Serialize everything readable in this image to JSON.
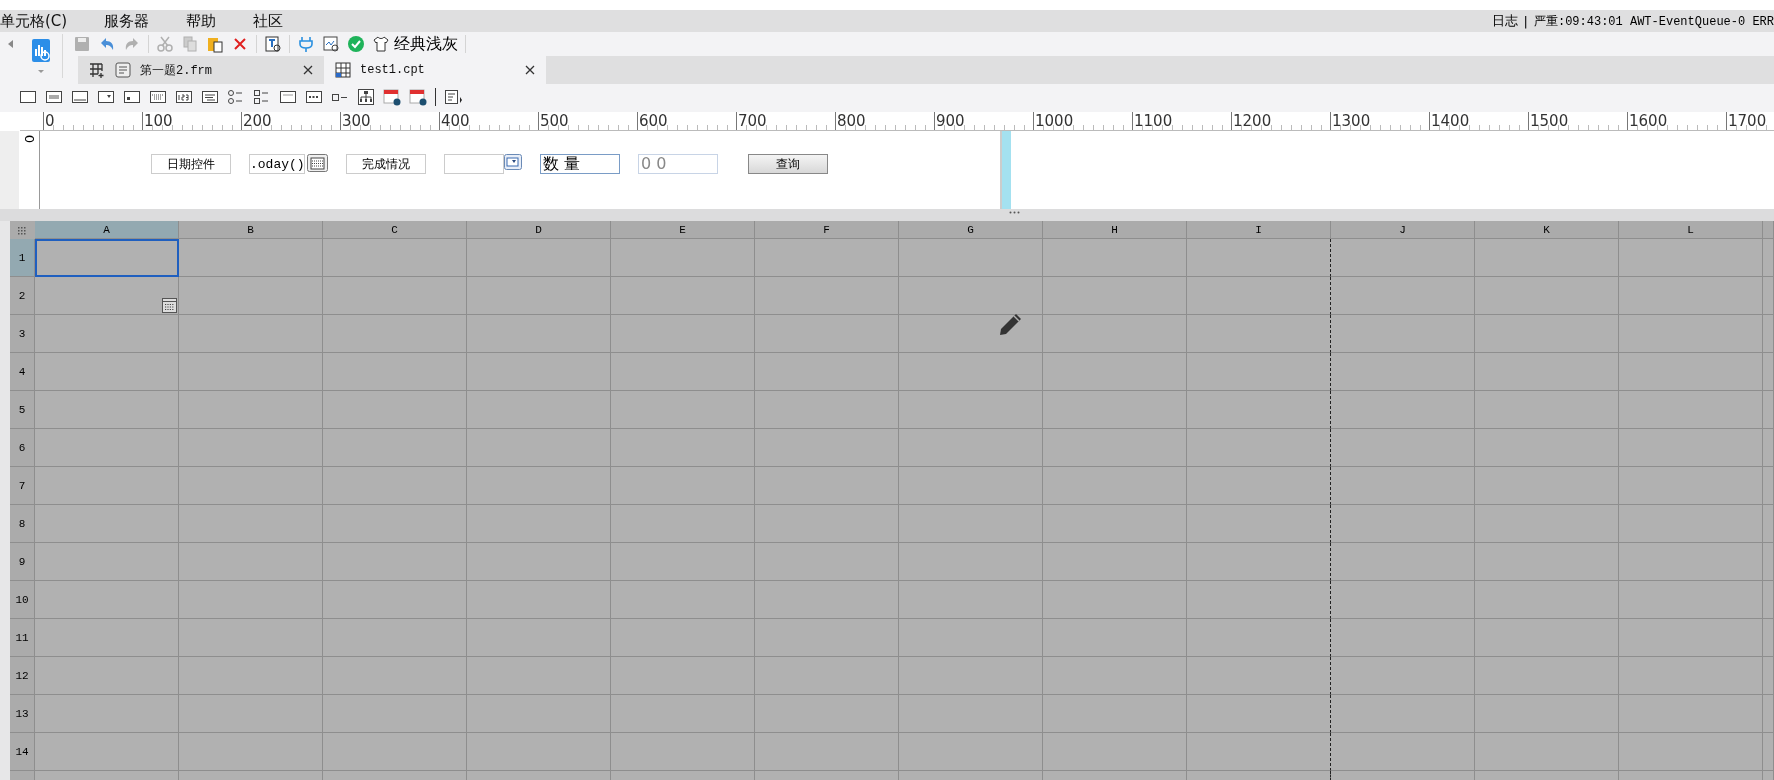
{
  "menu": [
    {
      "label": "单元格(C)"
    },
    {
      "label": "服务器"
    },
    {
      "label": "帮助"
    },
    {
      "label": "社区"
    }
  ],
  "log": {
    "label": "日志",
    "separator": "|",
    "message": "严重:09:43:01 AWT-EventQueue-0 ERR"
  },
  "toolbar": {
    "theme_label": "经典浅灰"
  },
  "tabs": [
    {
      "label": "第一题2.frm",
      "selected": false
    },
    {
      "label": "test1.cpt",
      "selected": true
    }
  ],
  "ruler": {
    "labels": [
      "0",
      "100",
      "200",
      "300",
      "400",
      "500",
      "600",
      "700",
      "800",
      "900",
      "1000",
      "1100",
      "1200",
      "1300",
      "1400",
      "1500",
      "1600",
      "1700"
    ],
    "vertical_label": "0"
  },
  "widgets": [
    {
      "kind": "label",
      "text": "日期控件"
    },
    {
      "kind": "date",
      "text": ".oday()"
    },
    {
      "kind": "label",
      "text": "完成情况"
    },
    {
      "kind": "combo"
    },
    {
      "kind": "text",
      "text": "数 量"
    },
    {
      "kind": "number",
      "text": "0 0"
    },
    {
      "kind": "button",
      "text": "查询"
    }
  ],
  "table": {
    "columns": [
      {
        "label": "A",
        "selected": true,
        "page_break": false
      },
      {
        "label": "B",
        "selected": false,
        "page_break": false
      },
      {
        "label": "C",
        "selected": false,
        "page_break": false
      },
      {
        "label": "D",
        "selected": false,
        "page_break": false
      },
      {
        "label": "E",
        "selected": false,
        "page_break": false
      },
      {
        "label": "F",
        "selected": false,
        "page_break": false
      },
      {
        "label": "G",
        "selected": false,
        "page_break": false
      },
      {
        "label": "H",
        "selected": false,
        "page_break": false
      },
      {
        "label": "I",
        "selected": false,
        "page_break": true
      },
      {
        "label": "J",
        "selected": false,
        "page_break": false
      },
      {
        "label": "K",
        "selected": false,
        "page_break": false
      },
      {
        "label": "L",
        "selected": false,
        "page_break": false
      }
    ],
    "rows": [
      {
        "label": "1",
        "selected": true
      },
      {
        "label": "2",
        "selected": false
      },
      {
        "label": "3",
        "selected": false
      },
      {
        "label": "4",
        "selected": false
      },
      {
        "label": "5",
        "selected": false
      },
      {
        "label": "6",
        "selected": false
      },
      {
        "label": "7",
        "selected": false
      },
      {
        "label": "8",
        "selected": false
      },
      {
        "label": "9",
        "selected": false
      },
      {
        "label": "10",
        "selected": false
      },
      {
        "label": "11",
        "selected": false
      },
      {
        "label": "12",
        "selected": false
      },
      {
        "label": "13",
        "selected": false
      },
      {
        "label": "14",
        "selected": false
      }
    ]
  }
}
